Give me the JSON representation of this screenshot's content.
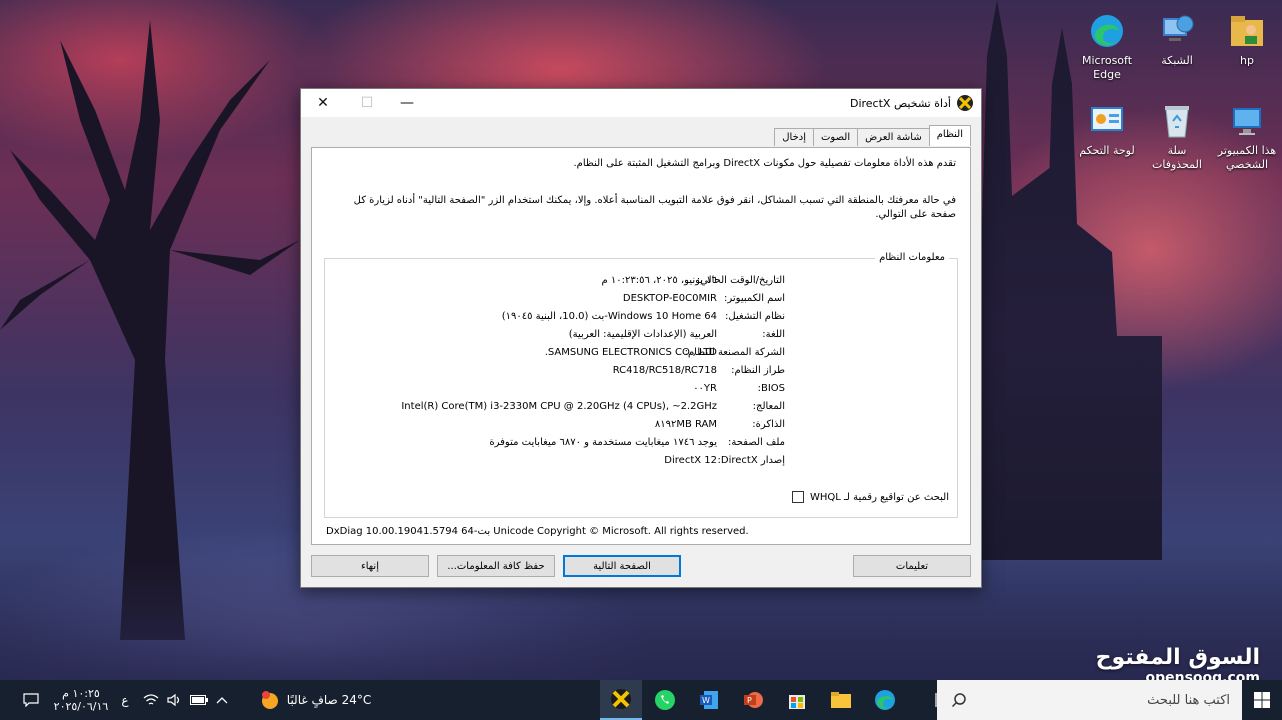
{
  "desktop": {
    "icons": [
      {
        "label": "hp"
      },
      {
        "label": "الشبكة"
      },
      {
        "label": "Microsoft Edge"
      },
      {
        "label": "هذا الكمبيوتر الشخصي"
      },
      {
        "label": "سلة المحذوفات"
      },
      {
        "label": "لوحة التحكم"
      }
    ]
  },
  "dialog": {
    "title": "أداة تشخيص DirectX",
    "tabs": [
      "النظام",
      "شاشة العرض",
      "الصوت",
      "إدخال"
    ],
    "intro1": "تقدم هذه الأداة معلومات تفصيلية حول مكونات DirectX وبرامج التشغيل المثبتة على النظام.",
    "intro2": "في حالة معرفتك بالمنطقة التي تسبب المشاكل، انقر فوق علامة التبويب المناسبة أعلاه. وإلا، يمكنك استخدام الزر \"الصفحة التالية\" أدناه لزيارة كل صفحة على التوالي.",
    "group_title": "معلومات النظام",
    "rows": [
      {
        "label": "التاريخ/الوقت الحالي:",
        "value": "١٦ يونيو، ٢٠٢٥، ١٠:٢٣:٥٦ م"
      },
      {
        "label": "اسم الكمبيوتر:",
        "value": "DESKTOP-E0C0MIR"
      },
      {
        "label": "نظام التشغيل:",
        "value": "Windows 10 Home 64-بت (10.0، البنية ١٩٠٤٥)"
      },
      {
        "label": "اللغة:",
        "value": "العربية (الإعدادات الإقليمية: العربية)"
      },
      {
        "label": "الشركة المصنعة للنظام:",
        "value": "SAMSUNG ELECTRONICS CO., LTD."
      },
      {
        "label": "طراز النظام:",
        "value": "RC418/RC518/RC718"
      },
      {
        "label": "BIOS:",
        "value": "٠٠YR"
      },
      {
        "label": "المعالج:",
        "value": "Intel(R) Core(TM) i3-2330M CPU @ 2.20GHz (4 CPUs), ~2.2GHz"
      },
      {
        "label": "الذاكرة:",
        "value": "٨١٩٢MB RAM"
      },
      {
        "label": "ملف الصفحة:",
        "value": "يوجد ١٧٤٦ ميغابايت مستخدمة و ٦٨٧٠ ميغابايت متوفرة"
      },
      {
        "label": "إصدار DirectX:",
        "value": "DirectX 12"
      }
    ],
    "whql_label": "البحث عن تواقيع رقمية لـ WHQL",
    "copyright": "DxDiag 10.00.19041.5794 64-بت Unicode  Copyright © Microsoft. All rights reserved.",
    "buttons": {
      "help": "تعليمات",
      "next": "الصفحة التالية",
      "save": "حفظ كافة المعلومات...",
      "exit": "إنهاء"
    }
  },
  "taskbar": {
    "search_placeholder": "اكتب هنا للبحث",
    "weather": "24°C صافٍ غالبًا",
    "lang": "ع",
    "time": "١٠:٢٥ م",
    "date": "٢٠٢٥/٠٦/١٦"
  },
  "watermark": {
    "brand": "السوق المفتوح",
    "site": "opensooq.com"
  }
}
